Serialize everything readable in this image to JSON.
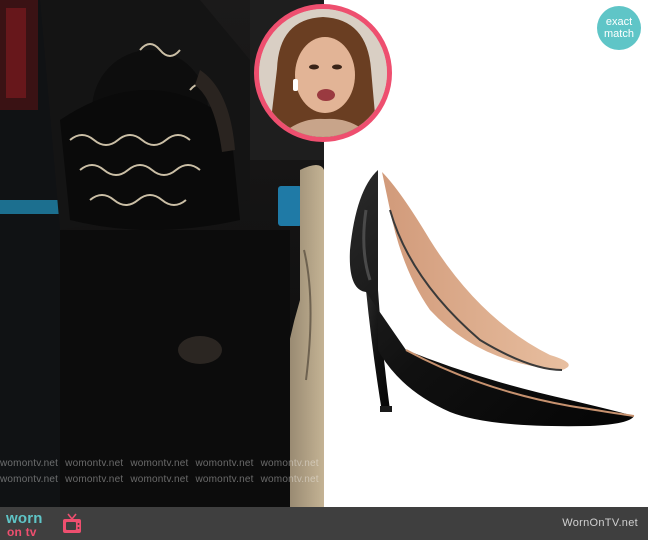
{
  "badge": {
    "line1": "exact",
    "line2": "match"
  },
  "watermark": {
    "row1": [
      "womontv.net",
      "womontv.net",
      "womontv.net",
      "womontv.net",
      "womontv.net"
    ],
    "row2": [
      "womontv.net",
      "womontv.net",
      "womontv.net",
      "womontv.net",
      "womontv.net"
    ]
  },
  "footer": {
    "logo_word1": "worn",
    "logo_word2": "on tv",
    "site": "WornOnTV.net"
  },
  "colors": {
    "accent_teal": "#5fc5c7",
    "accent_pink": "#ee4f6f",
    "footer_bg": "#3f3f3f"
  },
  "icons": [
    "tv-icon"
  ]
}
